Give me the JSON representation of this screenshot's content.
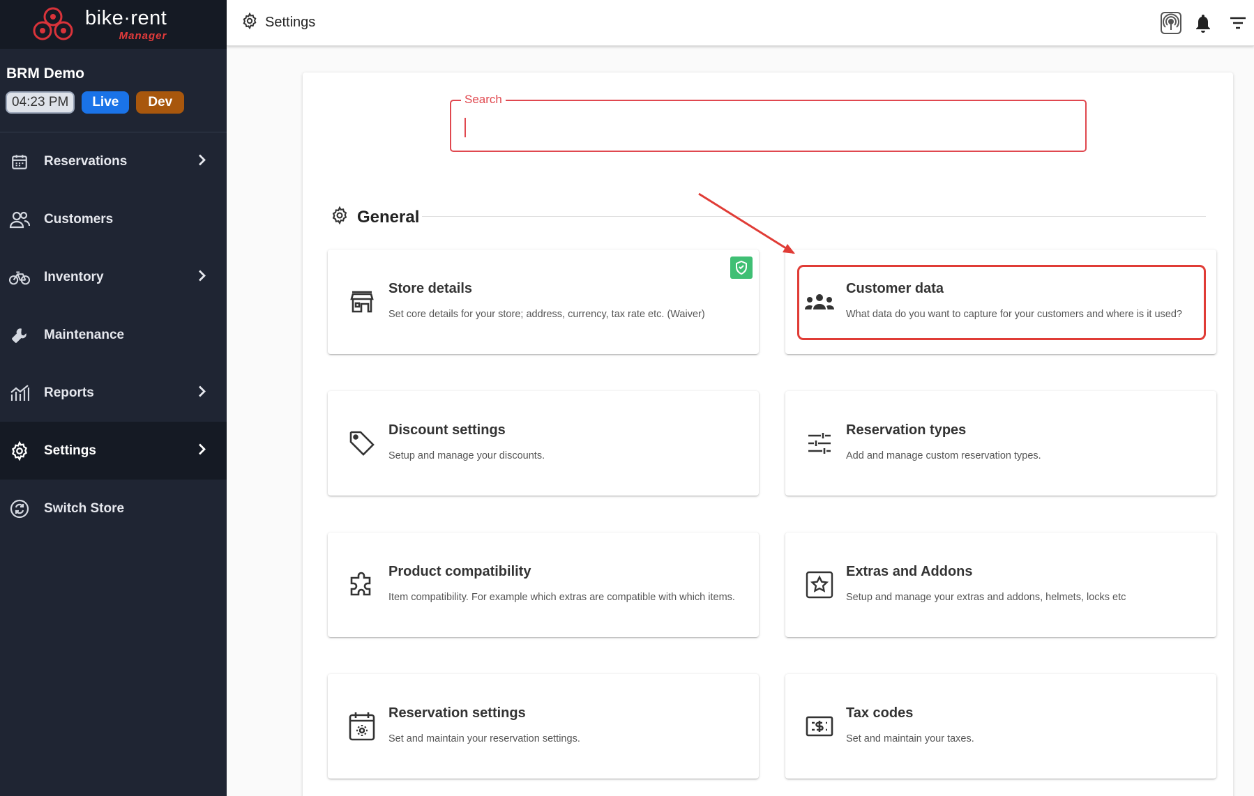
{
  "app": {
    "logo_main": "bike·rent",
    "logo_sub": "Manager"
  },
  "store": {
    "name": "BRM Demo",
    "time": "04:23 PM",
    "live": "Live",
    "dev": "Dev"
  },
  "nav": [
    {
      "label": "Reservations",
      "icon": "calendar-icon",
      "chevron": true
    },
    {
      "label": "Customers",
      "icon": "people-icon",
      "chevron": false
    },
    {
      "label": "Inventory",
      "icon": "bike-icon",
      "chevron": true
    },
    {
      "label": "Maintenance",
      "icon": "wrench-icon",
      "chevron": false
    },
    {
      "label": "Reports",
      "icon": "chart-icon",
      "chevron": true
    },
    {
      "label": "Settings",
      "icon": "gear-icon",
      "chevron": true,
      "active": true
    },
    {
      "label": "Switch Store",
      "icon": "switch-icon",
      "chevron": false
    }
  ],
  "topbar": {
    "title": "Settings"
  },
  "search": {
    "legend": "Search",
    "value": ""
  },
  "section": {
    "title": "General"
  },
  "cards": [
    {
      "title": "Store details",
      "desc": "Set core details for your store; address, currency, tax rate etc. (Waiver)",
      "icon": "store-icon"
    },
    {
      "title": "Customer data",
      "desc": "What data do you want to capture for your customers and where is it used?",
      "icon": "group-icon"
    },
    {
      "title": "Discount settings",
      "desc": "Setup and manage your discounts.",
      "icon": "tag-icon"
    },
    {
      "title": "Reservation types",
      "desc": "Add and manage custom reservation types.",
      "icon": "tune-icon"
    },
    {
      "title": "Product compatibility",
      "desc": "Item compatibility. For example which extras are compatible with which items.",
      "icon": "puzzle-icon"
    },
    {
      "title": "Extras and Addons",
      "desc": "Setup and manage your extras and addons, helmets, locks etc",
      "icon": "star-box-icon"
    },
    {
      "title": "Reservation settings",
      "desc": "Set and maintain your reservation settings.",
      "icon": "calendar-gear-icon"
    },
    {
      "title": "Tax codes",
      "desc": "Set and maintain your taxes.",
      "icon": "tax-icon"
    }
  ],
  "colors": {
    "accent": "#e0484f",
    "sidebar": "#1f2533",
    "live": "#1a73e8",
    "dev": "#a8570d",
    "shield": "#3fbf74"
  }
}
